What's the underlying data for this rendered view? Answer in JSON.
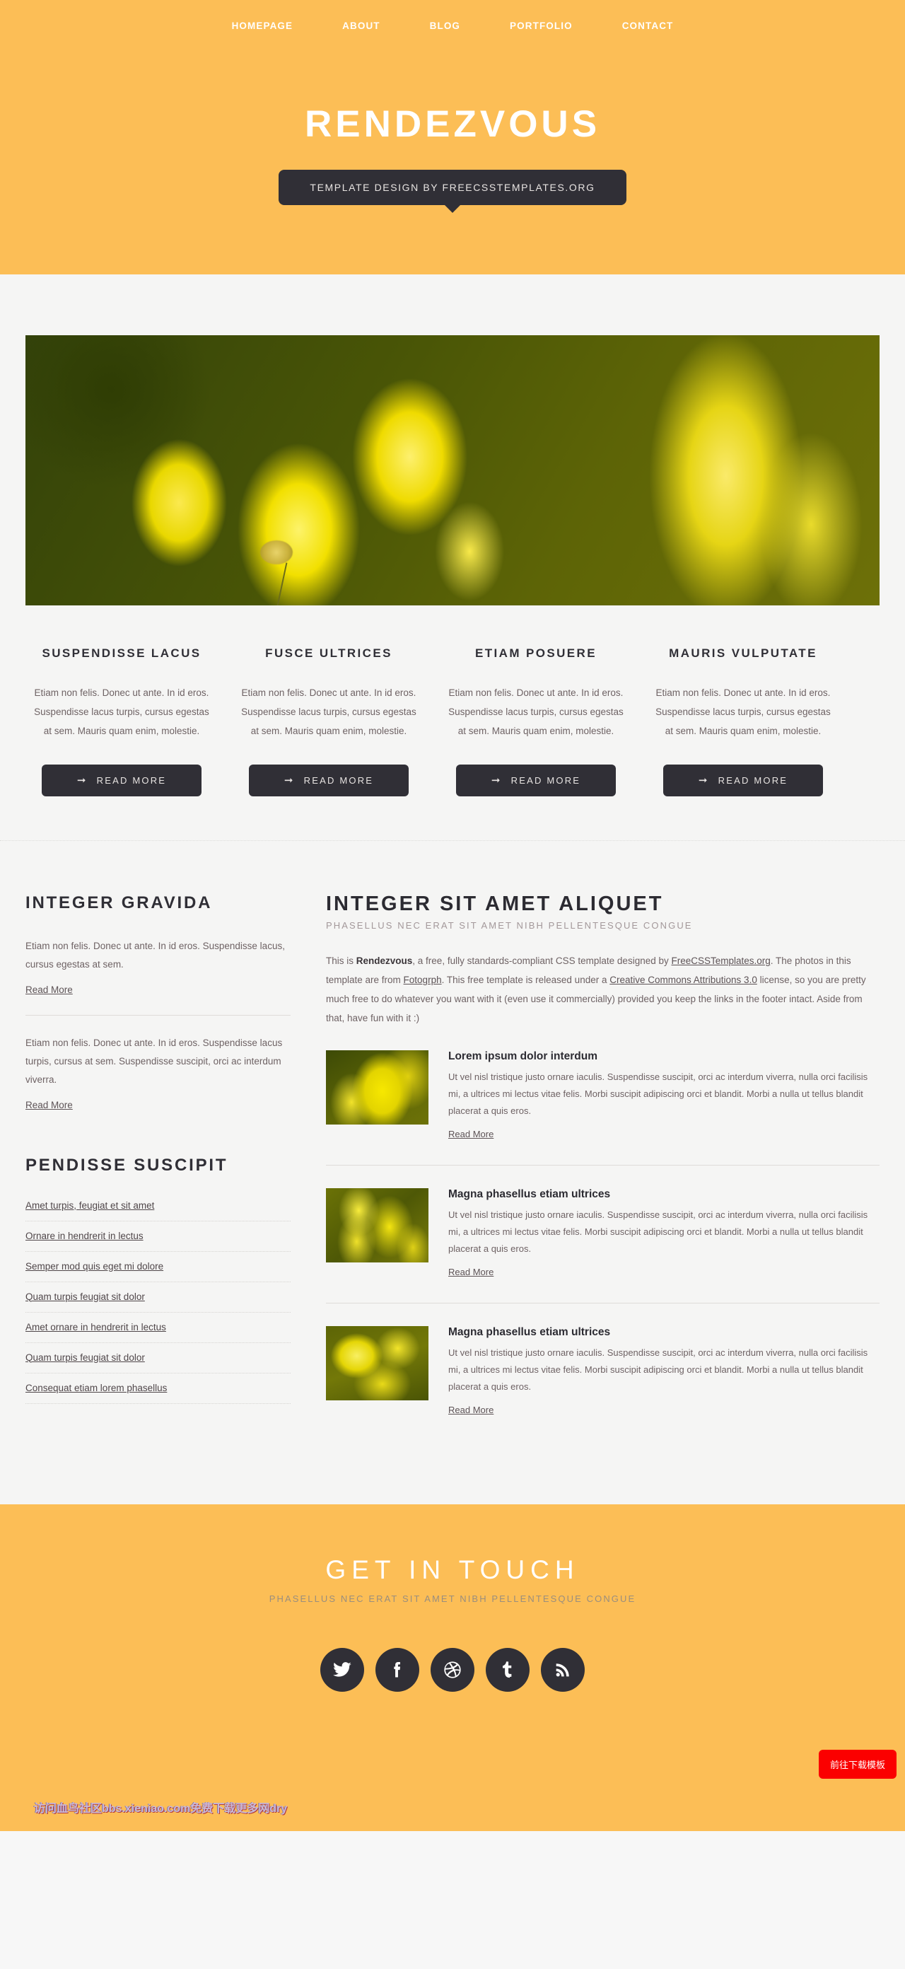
{
  "colors": {
    "accent": "#fcbe56",
    "dark": "#302f36",
    "page_bg": "#f5f5f4",
    "body_text": "#6e6264",
    "download_btn": "#fb0000"
  },
  "header": {
    "nav": [
      {
        "label": "HOMEPAGE",
        "name": "nav-homepage"
      },
      {
        "label": "ABOUT",
        "name": "nav-about"
      },
      {
        "label": "BLOG",
        "name": "nav-blog"
      },
      {
        "label": "PORTFOLIO",
        "name": "nav-portfolio"
      },
      {
        "label": "CONTACT",
        "name": "nav-contact"
      }
    ],
    "logo": "RENDEZVOUS",
    "tagline": "TEMPLATE DESIGN BY FREECSSTEMPLATES.ORG"
  },
  "banner": {
    "alt": "yellow-flowers-photo"
  },
  "columns": [
    {
      "title": "SUSPENDISSE LACUS",
      "text": "Etiam non felis. Donec ut ante. In id eros. Suspendisse lacus turpis, cursus egestas at sem. Mauris quam enim, molestie.",
      "button": "READ MORE"
    },
    {
      "title": "FUSCE ULTRICES",
      "text": "Etiam non felis. Donec ut ante. In id eros. Suspendisse lacus turpis, cursus egestas at sem. Mauris quam enim, molestie.",
      "button": "READ MORE"
    },
    {
      "title": "ETIAM POSUERE",
      "text": "Etiam non felis. Donec ut ante. In id eros. Suspendisse lacus turpis, cursus egestas at sem. Mauris quam enim, molestie.",
      "button": "READ MORE"
    },
    {
      "title": "MAURIS VULPUTATE",
      "text": "Etiam non felis. Donec ut ante. In id eros. Suspendisse lacus turpis, cursus egestas at sem. Mauris quam enim, molestie.",
      "button": "READ MORE"
    }
  ],
  "sidebar": {
    "gravida_title": "INTEGER GRAVIDA",
    "blocks": [
      {
        "text": "Etiam non felis. Donec ut ante. In id eros. Suspendisse lacus, cursus egestas at sem.",
        "link": "Read More"
      },
      {
        "text": "Etiam non felis. Donec ut ante. In id eros. Suspendisse lacus turpis, cursus at sem. Suspendisse suscipit, orci ac interdum viverra.",
        "link": "Read More"
      }
    ],
    "list_title": "PENDISSE SUSCIPIT",
    "list": [
      "Amet turpis, feugiat et sit amet",
      "Ornare in hendrerit in lectus",
      "Semper mod quis eget mi dolore",
      "Quam turpis feugiat sit dolor",
      "Amet ornare in hendrerit in lectus",
      "Quam turpis feugiat sit dolor",
      "Consequat etiam lorem phasellus"
    ]
  },
  "content": {
    "title": "INTEGER SIT AMET ALIQUET",
    "subtitle": "PHASELLUS NEC ERAT SIT AMET NIBH PELLENTESQUE CONGUE",
    "intro": {
      "p1": "This is ",
      "brand": "Rendezvous",
      "p2": ", a free, fully standards-compliant CSS template designed by ",
      "link1": "FreeCSSTemplates.org",
      "p3": ". The photos in this template are from ",
      "link2": "Fotogrph",
      "p4": ". This free template is released under a ",
      "link3": "Creative Commons Attributions 3.0",
      "p5": " license, so you are pretty much free to do whatever you want with it (even use it commercially) provided you keep the links in the footer intact. Aside from that, have fun with it :)"
    },
    "articles": [
      {
        "title": "Lorem ipsum dolor interdum",
        "text": "Ut vel nisl tristique justo ornare iaculis. Suspendisse suscipit, orci ac interdum viverra, nulla orci facilisis mi, a ultrices mi lectus vitae felis. Morbi suscipit adipiscing orci et blandit. Morbi a nulla ut tellus blandit placerat a quis eros.",
        "link": "Read More"
      },
      {
        "title": "Magna phasellus etiam ultrices",
        "text": "Ut vel nisl tristique justo ornare iaculis. Suspendisse suscipit, orci ac interdum viverra, nulla orci facilisis mi, a ultrices mi lectus vitae felis. Morbi suscipit adipiscing orci et blandit. Morbi a nulla ut tellus blandit placerat a quis eros.",
        "link": "Read More"
      },
      {
        "title": "Magna phasellus etiam ultrices",
        "text": "Ut vel nisl tristique justo ornare iaculis. Suspendisse suscipit, orci ac interdum viverra, nulla orci facilisis mi, a ultrices mi lectus vitae felis. Morbi suscipit adipiscing orci et blandit. Morbi a nulla ut tellus blandit placerat a quis eros.",
        "link": "Read More"
      }
    ]
  },
  "footer": {
    "title": "GET IN TOUCH",
    "subtitle": "PHASELLUS NEC ERAT SIT AMET NIBH PELLENTESQUE CONGUE",
    "social": [
      {
        "name": "twitter-icon",
        "label": "Twitter"
      },
      {
        "name": "facebook-icon",
        "label": "Facebook"
      },
      {
        "name": "dribbble-icon",
        "label": "Dribbble"
      },
      {
        "name": "tumblr-icon",
        "label": "Tumblr"
      },
      {
        "name": "rss-icon",
        "label": "RSS"
      }
    ]
  },
  "overlay": {
    "watermark": "访问血鸟社区bbs.xieniao.com免费下载更多网dry",
    "download_button": "前往下载模板"
  }
}
